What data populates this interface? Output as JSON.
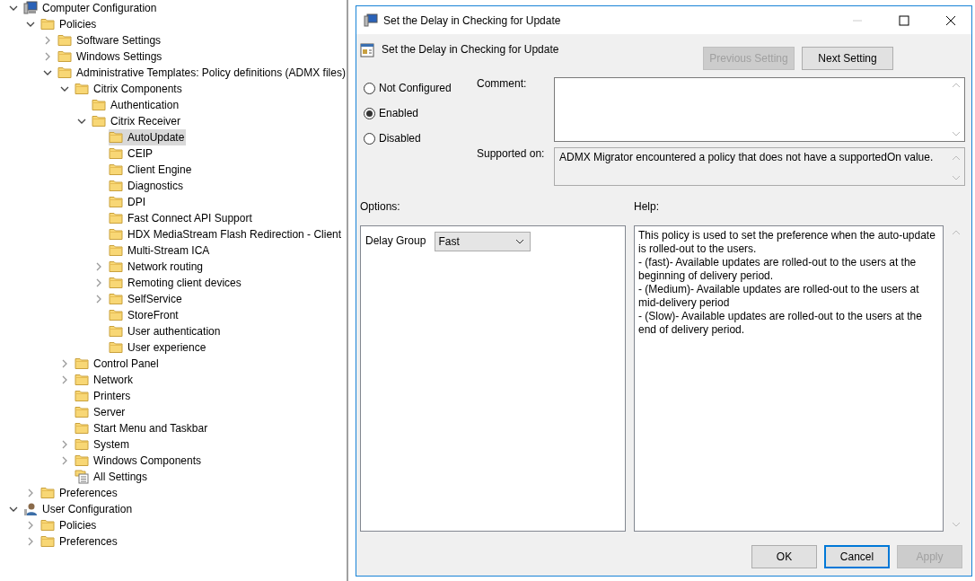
{
  "tree": [
    {
      "label": "Computer Configuration",
      "kind": "computer",
      "expanded": true,
      "selected": false,
      "children": [
        {
          "label": "Policies",
          "kind": "folder",
          "expanded": true,
          "selected": false,
          "children": [
            {
              "label": "Software Settings",
              "kind": "folder",
              "expanded": false,
              "selected": false
            },
            {
              "label": "Windows Settings",
              "kind": "folder",
              "expanded": false,
              "selected": false
            },
            {
              "label": "Administrative Templates: Policy definitions (ADMX files)",
              "kind": "folder",
              "expanded": true,
              "selected": false,
              "children": [
                {
                  "label": "Citrix Components",
                  "kind": "folder",
                  "expanded": true,
                  "selected": false,
                  "children": [
                    {
                      "label": "Authentication",
                      "kind": "folder",
                      "selected": false
                    },
                    {
                      "label": "Citrix Receiver",
                      "kind": "folder",
                      "expanded": true,
                      "selected": false,
                      "children": [
                        {
                          "label": "AutoUpdate",
                          "kind": "folder",
                          "selected": true
                        },
                        {
                          "label": "CEIP",
                          "kind": "folder",
                          "selected": false
                        },
                        {
                          "label": "Client Engine",
                          "kind": "folder",
                          "selected": false
                        },
                        {
                          "label": "Diagnostics",
                          "kind": "folder",
                          "selected": false
                        },
                        {
                          "label": "DPI",
                          "kind": "folder",
                          "selected": false
                        },
                        {
                          "label": "Fast Connect API Support",
                          "kind": "folder",
                          "selected": false
                        },
                        {
                          "label": "HDX MediaStream Flash Redirection - Client",
                          "kind": "folder",
                          "selected": false
                        },
                        {
                          "label": "Multi-Stream ICA",
                          "kind": "folder",
                          "selected": false
                        },
                        {
                          "label": "Network routing",
                          "kind": "folder",
                          "expanded": false,
                          "selected": false
                        },
                        {
                          "label": "Remoting client devices",
                          "kind": "folder",
                          "expanded": false,
                          "selected": false
                        },
                        {
                          "label": "SelfService",
                          "kind": "folder",
                          "expanded": false,
                          "selected": false
                        },
                        {
                          "label": "StoreFront",
                          "kind": "folder",
                          "selected": false
                        },
                        {
                          "label": "User authentication",
                          "kind": "folder",
                          "selected": false
                        },
                        {
                          "label": "User experience",
                          "kind": "folder",
                          "selected": false
                        }
                      ]
                    }
                  ]
                },
                {
                  "label": "Control Panel",
                  "kind": "folder",
                  "expanded": false,
                  "selected": false
                },
                {
                  "label": "Network",
                  "kind": "folder",
                  "expanded": false,
                  "selected": false
                },
                {
                  "label": "Printers",
                  "kind": "folder",
                  "selected": false
                },
                {
                  "label": "Server",
                  "kind": "folder",
                  "selected": false
                },
                {
                  "label": "Start Menu and Taskbar",
                  "kind": "folder",
                  "selected": false
                },
                {
                  "label": "System",
                  "kind": "folder",
                  "expanded": false,
                  "selected": false
                },
                {
                  "label": "Windows Components",
                  "kind": "folder",
                  "expanded": false,
                  "selected": false
                },
                {
                  "label": "All Settings",
                  "kind": "settings",
                  "selected": false
                }
              ]
            }
          ]
        },
        {
          "label": "Preferences",
          "kind": "folder",
          "expanded": false,
          "selected": false
        }
      ]
    },
    {
      "label": "User Configuration",
      "kind": "user",
      "expanded": true,
      "selected": false,
      "children": [
        {
          "label": "Policies",
          "kind": "folder",
          "expanded": false,
          "selected": false
        },
        {
          "label": "Preferences",
          "kind": "folder",
          "expanded": false,
          "selected": false
        }
      ]
    }
  ],
  "dialog": {
    "title": "Set the Delay in Checking for Update",
    "heading": "Set the Delay in Checking for Update",
    "nav_buttons": [
      {
        "label": "Previous Setting",
        "disabled": true
      },
      {
        "label": "Next Setting",
        "disabled": false
      }
    ],
    "states": [
      {
        "label": "Not Configured",
        "selected": false
      },
      {
        "label": "Enabled",
        "selected": true
      },
      {
        "label": "Disabled",
        "selected": false
      }
    ],
    "comment_label": "Comment:",
    "supported_label": "Supported on:",
    "supported_text": "ADMX Migrator encountered a policy that does not have a supportedOn value.",
    "options_label": "Options:",
    "help_label": "Help:",
    "option": {
      "label": "Delay Group",
      "value": "Fast"
    },
    "help_text": "This policy is used to set the preference when the auto-update is rolled-out to the users.\n- (fast)- Available updates are rolled-out to the users at the beginning of delivery period.\n- (Medium)- Available updates are rolled-out to the users at mid-delivery period\n- (Slow)- Available updates are rolled-out to the users at the end of delivery period.",
    "buttons": [
      {
        "label": "OK",
        "disabled": false,
        "focused": false
      },
      {
        "label": "Cancel",
        "disabled": false,
        "focused": true
      },
      {
        "label": "Apply",
        "disabled": true,
        "focused": false
      }
    ]
  }
}
